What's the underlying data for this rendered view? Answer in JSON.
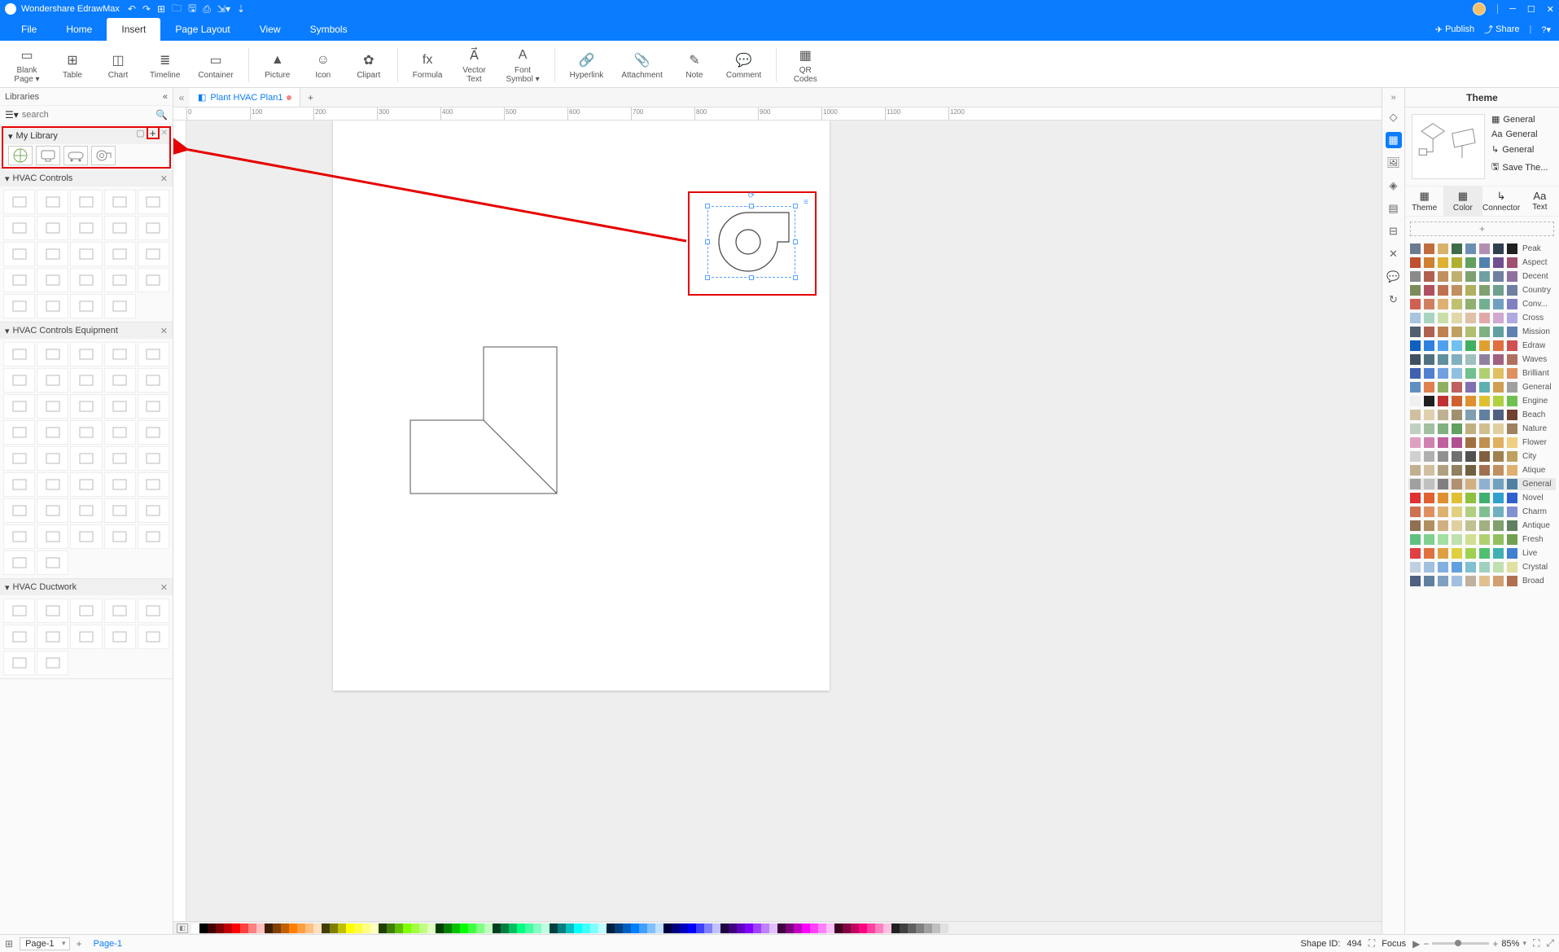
{
  "title": "Wondershare EdrawMax",
  "menu": {
    "tabs": [
      "File",
      "Home",
      "Insert",
      "Page Layout",
      "View",
      "Symbols"
    ],
    "active": "Insert",
    "right": [
      {
        "icon": "✈",
        "label": "Publish"
      },
      {
        "icon": "⇪",
        "label": "Share"
      }
    ]
  },
  "ribbon": [
    {
      "icon": "▭",
      "label": "Blank\nPage ▾"
    },
    {
      "icon": "⊞",
      "label": "Table"
    },
    {
      "icon": "◫",
      "label": "Chart"
    },
    {
      "icon": "≣",
      "label": "Timeline"
    },
    {
      "icon": "▭",
      "label": "Container"
    },
    {
      "sep": true
    },
    {
      "icon": "▲",
      "label": "Picture"
    },
    {
      "icon": "☺",
      "label": "Icon"
    },
    {
      "icon": "✿",
      "label": "Clipart"
    },
    {
      "sep": true
    },
    {
      "icon": "fx",
      "label": "Formula"
    },
    {
      "icon": "A⃗",
      "label": "Vector\nText"
    },
    {
      "icon": "A",
      "label": "Font\nSymbol ▾"
    },
    {
      "sep": true
    },
    {
      "icon": "🔗",
      "label": "Hyperlink"
    },
    {
      "icon": "📎",
      "label": "Attachment"
    },
    {
      "icon": "✎",
      "label": "Note"
    },
    {
      "icon": "💬",
      "label": "Comment"
    },
    {
      "sep": true
    },
    {
      "icon": "▦",
      "label": "QR\nCodes"
    }
  ],
  "libraries": {
    "title": "Libraries",
    "search_placeholder": "search",
    "mylib": {
      "title": "My Library",
      "count": 4
    },
    "sections": [
      {
        "title": "HVAC Controls",
        "cells": 24
      },
      {
        "title": "HVAC Controls Equipment",
        "cells": 42
      },
      {
        "title": "HVAC Ductwork",
        "cells": 12
      }
    ]
  },
  "doc": {
    "tab": "Plant HVAC Plan1",
    "modified": true
  },
  "theme": {
    "title": "Theme",
    "general_items": [
      "General",
      "General",
      "General",
      "Save The..."
    ],
    "subtabs": [
      "Theme",
      "Color",
      "Connector",
      "Text"
    ],
    "subtab_active": "Color",
    "schemes": [
      {
        "name": "Peak",
        "c": [
          "#6b7a8f",
          "#c06c3e",
          "#d9b26a",
          "#3e6b4a",
          "#6b8fb2",
          "#b28fb2",
          "#304050",
          "#202020"
        ]
      },
      {
        "name": "Aspect",
        "c": [
          "#c05030",
          "#d08030",
          "#e0b030",
          "#b0b030",
          "#60a060",
          "#5080b0",
          "#705090",
          "#a05070"
        ]
      },
      {
        "name": "Decent",
        "c": [
          "#8a8a8a",
          "#b06050",
          "#c09060",
          "#c0b070",
          "#80a070",
          "#70a0a0",
          "#7080a0",
          "#9070a0"
        ]
      },
      {
        "name": "Country",
        "c": [
          "#7b8b5b",
          "#b05060",
          "#c07050",
          "#c09060",
          "#b0b060",
          "#80a070",
          "#70a090",
          "#7080a0"
        ]
      },
      {
        "name": "Conv...",
        "c": [
          "#d06050",
          "#d08060",
          "#e0b070",
          "#c0c070",
          "#90b070",
          "#70b090",
          "#70a0c0",
          "#8080c0"
        ]
      },
      {
        "name": "Cross",
        "c": [
          "#a8c4e0",
          "#a8d4c0",
          "#c8e0a8",
          "#e0d8a8",
          "#e0c0a8",
          "#e0a8a8",
          "#d0a8d0",
          "#b0a8e0"
        ]
      },
      {
        "name": "Mission",
        "c": [
          "#506070",
          "#b06050",
          "#c08050",
          "#c0a060",
          "#b0c070",
          "#80b080",
          "#60a0a0",
          "#6080b0"
        ]
      },
      {
        "name": "Edraw",
        "c": [
          "#1060c0",
          "#3080e0",
          "#50a0f0",
          "#70c0f0",
          "#40b060",
          "#e0a030",
          "#e07040",
          "#d05050"
        ]
      },
      {
        "name": "Waves",
        "c": [
          "#405060",
          "#507080",
          "#6090a0",
          "#80b0c0",
          "#a0c0c0",
          "#9080a0",
          "#a06080",
          "#b07060"
        ]
      },
      {
        "name": "Brilliant",
        "c": [
          "#4060b0",
          "#5080d0",
          "#70a0e0",
          "#90c0e0",
          "#70c090",
          "#b0d070",
          "#e0c060",
          "#e09060"
        ]
      },
      {
        "name": "General",
        "c": [
          "#6090c0",
          "#e08050",
          "#90b060",
          "#c06060",
          "#8070b0",
          "#60b0b0",
          "#d0a050",
          "#a0a0a0"
        ]
      },
      {
        "name": "Engine",
        "c": [
          "#f0f0f0",
          "#202020",
          "#c03030",
          "#d06030",
          "#e09030",
          "#e0c030",
          "#b0d040",
          "#70c050"
        ]
      },
      {
        "name": "Beach",
        "c": [
          "#d0c0a0",
          "#e0d0b0",
          "#c0b090",
          "#a09070",
          "#80a0b0",
          "#6080a0",
          "#506080",
          "#704030"
        ]
      },
      {
        "name": "Nature",
        "c": [
          "#c0d0c0",
          "#a0c0a0",
          "#80b080",
          "#60a060",
          "#c0b080",
          "#d0c090",
          "#e0d0a0",
          "#a08060"
        ]
      },
      {
        "name": "Flower",
        "c": [
          "#e0a0c0",
          "#d080b0",
          "#c060a0",
          "#b05090",
          "#a07040",
          "#c09050",
          "#e0b060",
          "#f0d080"
        ]
      },
      {
        "name": "City",
        "c": [
          "#d0d0d0",
          "#b0b0b0",
          "#909090",
          "#707070",
          "#505050",
          "#806040",
          "#a08050",
          "#c0a060"
        ]
      },
      {
        "name": "Atique",
        "c": [
          "#c0b090",
          "#d0c0a0",
          "#b0a080",
          "#908060",
          "#706040",
          "#a07050",
          "#c09060",
          "#e0b070"
        ]
      },
      {
        "name": "General",
        "c": [
          "#a0a0a0",
          "#c0c0c0",
          "#808080",
          "#b09070",
          "#d0b080",
          "#90b0d0",
          "#70a0c0",
          "#5080a0"
        ],
        "sel": true
      },
      {
        "name": "Novel",
        "c": [
          "#e03030",
          "#e06030",
          "#e09030",
          "#e0c030",
          "#90c040",
          "#40b070",
          "#30a0d0",
          "#3060d0"
        ]
      },
      {
        "name": "Charm",
        "c": [
          "#d07050",
          "#e09060",
          "#e0b070",
          "#e0d080",
          "#b0d080",
          "#80c090",
          "#70b0c0",
          "#8090d0"
        ]
      },
      {
        "name": "Antique",
        "c": [
          "#907050",
          "#b09060",
          "#d0b080",
          "#e0d0a0",
          "#c0c090",
          "#a0b080",
          "#80a070",
          "#608060"
        ]
      },
      {
        "name": "Fresh",
        "c": [
          "#60c080",
          "#80d090",
          "#a0e0a0",
          "#c0e0b0",
          "#d0e090",
          "#b0d070",
          "#90c060",
          "#70a050"
        ]
      },
      {
        "name": "Live",
        "c": [
          "#e04040",
          "#e07040",
          "#e0a040",
          "#e0d040",
          "#a0d050",
          "#50c070",
          "#40b0b0",
          "#4080d0"
        ]
      },
      {
        "name": "Crystal",
        "c": [
          "#c0d0e0",
          "#a0c0e0",
          "#80b0e0",
          "#60a0e0",
          "#80c0d0",
          "#a0d0c0",
          "#c0e0b0",
          "#e0e0a0"
        ]
      },
      {
        "name": "Broad",
        "c": [
          "#506080",
          "#6080a0",
          "#80a0c0",
          "#a0c0e0",
          "#c0b0a0",
          "#e0c090",
          "#d0a070",
          "#b07050"
        ]
      }
    ]
  },
  "status": {
    "page_sel": "Page-1",
    "page_tab": "Page-1",
    "shape_id_label": "Shape ID:",
    "shape_id": "494",
    "focus": "Focus",
    "zoom": "85%"
  },
  "bottom_colors": [
    "#ffffff",
    "#000000",
    "#400000",
    "#800000",
    "#c00000",
    "#ff0000",
    "#ff4040",
    "#ff8080",
    "#ffc0c0",
    "#402000",
    "#804000",
    "#c06000",
    "#ff8000",
    "#ffa040",
    "#ffc080",
    "#ffe0c0",
    "#404000",
    "#808000",
    "#c0c000",
    "#ffff00",
    "#ffff40",
    "#ffff80",
    "#ffffc0",
    "#204000",
    "#408000",
    "#60c000",
    "#80ff00",
    "#a0ff40",
    "#c0ff80",
    "#e0ffc0",
    "#004000",
    "#008000",
    "#00c000",
    "#00ff00",
    "#40ff40",
    "#80ff80",
    "#c0ffc0",
    "#004020",
    "#008040",
    "#00c060",
    "#00ff80",
    "#40ffa0",
    "#80ffc0",
    "#c0ffe0",
    "#004040",
    "#008080",
    "#00c0c0",
    "#00ffff",
    "#40ffff",
    "#80ffff",
    "#c0ffff",
    "#002040",
    "#004080",
    "#0060c0",
    "#0080ff",
    "#40a0ff",
    "#80c0ff",
    "#c0e0ff",
    "#000040",
    "#000080",
    "#0000c0",
    "#0000ff",
    "#4040ff",
    "#8080ff",
    "#c0c0ff",
    "#200040",
    "#400080",
    "#6000c0",
    "#8000ff",
    "#a040ff",
    "#c080ff",
    "#e0c0ff",
    "#400040",
    "#800080",
    "#c000c0",
    "#ff00ff",
    "#ff40ff",
    "#ff80ff",
    "#ffc0ff",
    "#400020",
    "#800040",
    "#c00060",
    "#ff0080",
    "#ff40a0",
    "#ff80c0",
    "#ffc0e0",
    "#202020",
    "#404040",
    "#606060",
    "#808080",
    "#a0a0a0",
    "#c0c0c0",
    "#e0e0e0"
  ]
}
